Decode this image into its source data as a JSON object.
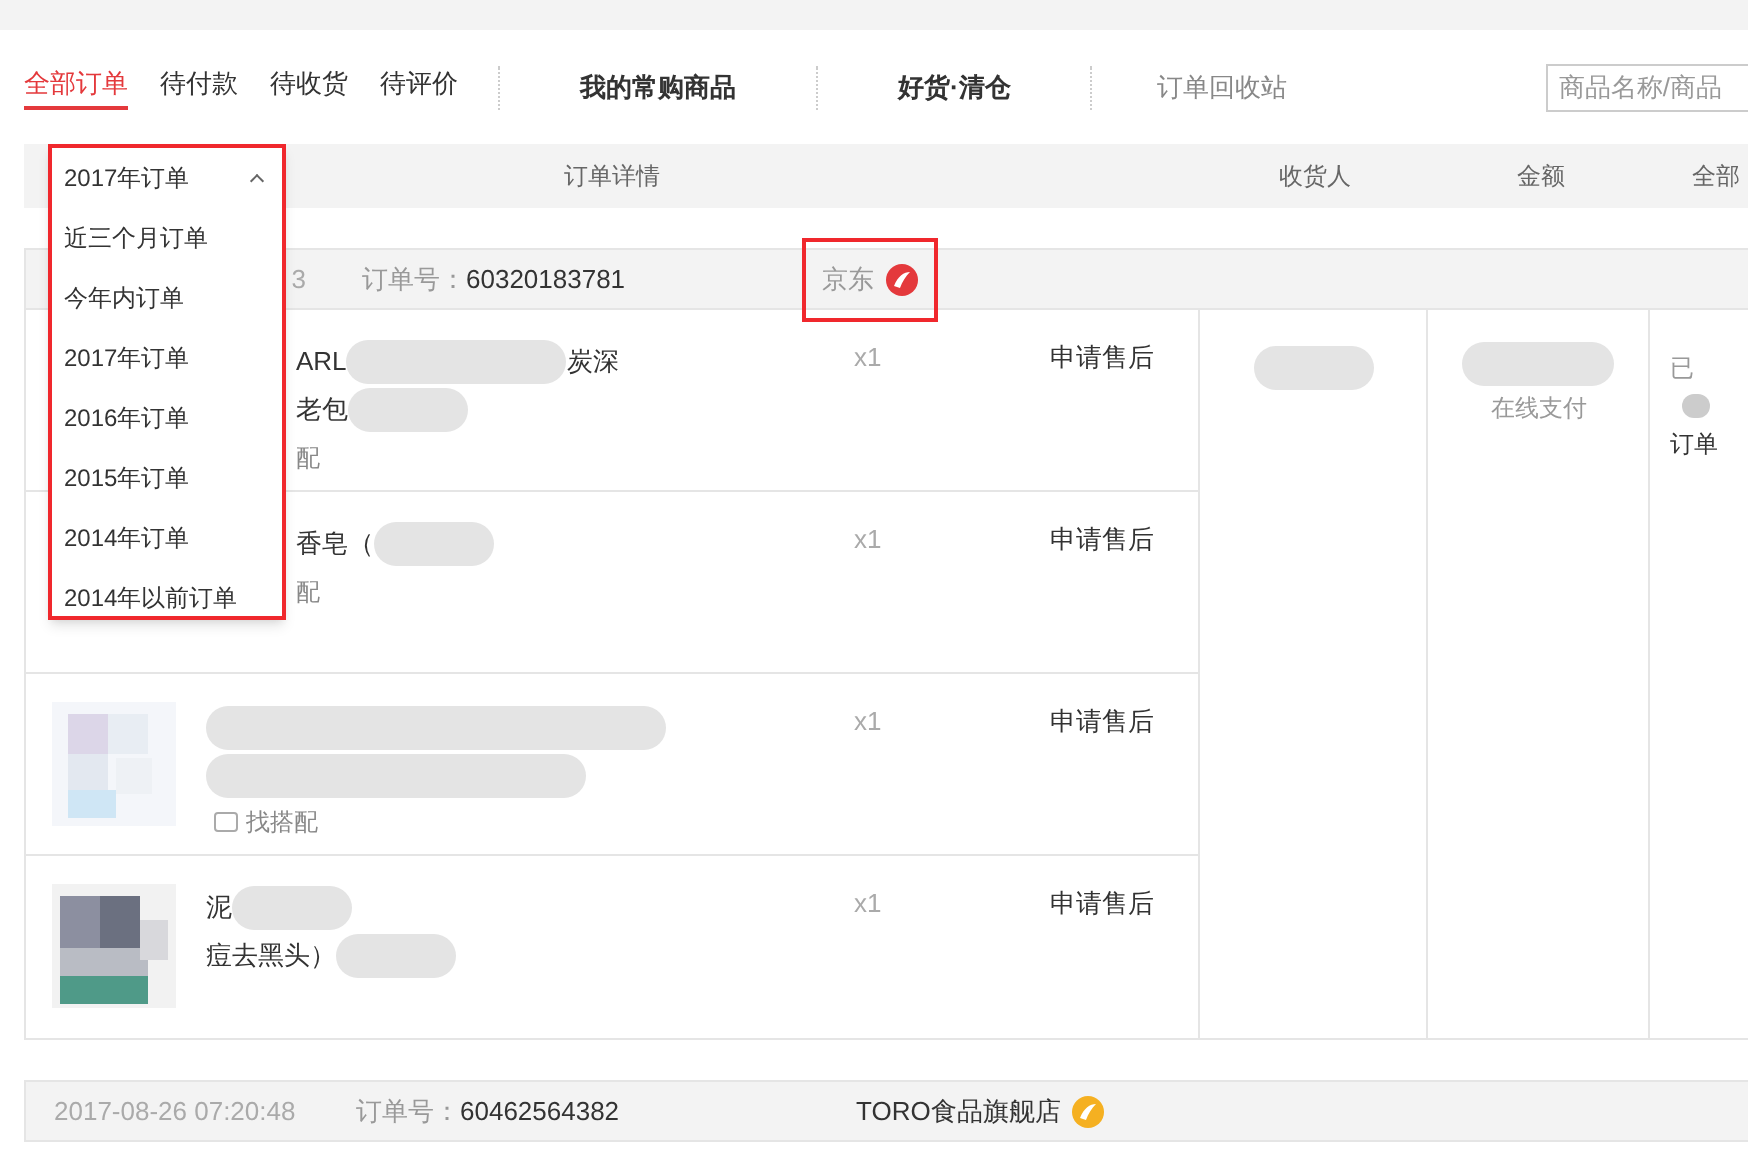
{
  "tabs": [
    {
      "label": "全部订单",
      "selected": true
    },
    {
      "label": "待付款",
      "selected": false
    },
    {
      "label": "待收货",
      "selected": false
    },
    {
      "label": "待评价",
      "selected": false
    }
  ],
  "links": [
    "我的常购商品",
    "好货·清仓"
  ],
  "recycle_bin": "订单回收站",
  "search": {
    "placeholder": "商品名称/商品"
  },
  "columns": [
    "订单详情",
    "收货人",
    "金额",
    "全部"
  ],
  "period_dropdown": {
    "value": "2017年订单",
    "expanded": true,
    "options": [
      "近三个月订单",
      "今年内订单",
      "2017年订单",
      "2016年订单",
      "2015年订单",
      "2014年订单",
      "2014年以前订单"
    ]
  },
  "orders": [
    {
      "date": "3",
      "order_no_label": "订单号：",
      "order_no": "60320183781",
      "shop": "京东",
      "shop_highlighted": true,
      "color": "#e4393c",
      "payment": "在线支付",
      "status_lines": [
        "已",
        "订单"
      ],
      "items": [
        {
          "lines": [
            [
              "ARL",
              "炭深"
            ],
            [
              "老包"
            ]
          ],
          "match": "配",
          "qty": "x1",
          "action": "申请售后"
        },
        {
          "lines": [
            [
              "香皂（"
            ]
          ],
          "match": "配",
          "qty": "x1",
          "action": "申请售后"
        },
        {
          "thumb": {
            "kind": "picture"
          },
          "match": "找搭配",
          "qty": "x1",
          "action": "申请售后"
        },
        {
          "thumb": {
            "kind": "picture"
          },
          "lines": [
            [
              "泥"
            ],
            [
              "痘去黑头）"
            ]
          ],
          "qty": "x1",
          "action": "申请售后"
        }
      ]
    },
    {
      "date": "2017-08-26 07:20:48",
      "order_no_label": "订单号：",
      "order_no": "60462564382",
      "shop": "TORO食品旗舰店",
      "shop_highlighted": false,
      "color": "#f5b021"
    }
  ]
}
